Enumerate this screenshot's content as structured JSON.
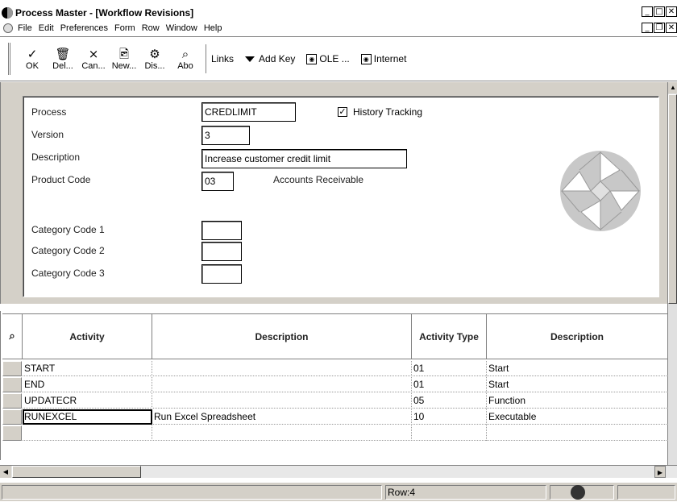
{
  "window": {
    "title": "Process Master - [Workflow Revisions]"
  },
  "menu": [
    "File",
    "Edit",
    "Preferences",
    "Form",
    "Row",
    "Window",
    "Help"
  ],
  "toolbar": {
    "buttons": [
      {
        "icon": "✓",
        "label": "OK",
        "icon_name": "check-icon"
      },
      {
        "icon": "🗑",
        "label": "Del...",
        "icon_name": "trash-icon"
      },
      {
        "icon": "×",
        "label": "Can...",
        "icon_name": "cancel-icon"
      },
      {
        "icon": "🖻",
        "label": "New...",
        "icon_name": "new-icon"
      },
      {
        "icon": "⚙",
        "label": "Dis...",
        "icon_name": "display-icon"
      },
      {
        "icon": "⌕",
        "label": "Abo",
        "icon_name": "about-icon"
      }
    ],
    "links_label": "Links",
    "add_key_label": "Add Key",
    "ole_label": "OLE ...",
    "internet_label": "Internet"
  },
  "form": {
    "process_label": "Process",
    "process_value": "CREDLIMIT",
    "history_label": "History Tracking",
    "history_checked": true,
    "version_label": "Version",
    "version_value": "3",
    "description_label": "Description",
    "description_value": "Increase customer credit limit",
    "product_code_label": "Product Code",
    "product_code_value": "03",
    "product_code_desc": "Accounts Receivable",
    "cat1_label": "Category Code 1",
    "cat2_label": "Category Code 2",
    "cat3_label": "Category Code 3",
    "cat1_value": "",
    "cat2_value": "",
    "cat3_value": ""
  },
  "grid": {
    "columns": [
      "Activity",
      "Description",
      "Activity Type",
      "Description"
    ],
    "rows": [
      {
        "activity": "START",
        "description": "",
        "type": "01",
        "type_desc": "Start"
      },
      {
        "activity": "END",
        "description": "",
        "type": "01",
        "type_desc": "Start"
      },
      {
        "activity": "UPDATECR",
        "description": "",
        "type": "05",
        "type_desc": "Function"
      },
      {
        "activity": "RUNEXCEL",
        "description": "Run Excel Spreadsheet",
        "type": "10",
        "type_desc": "Executable"
      }
    ]
  },
  "status": {
    "row_text": "Row:4"
  }
}
